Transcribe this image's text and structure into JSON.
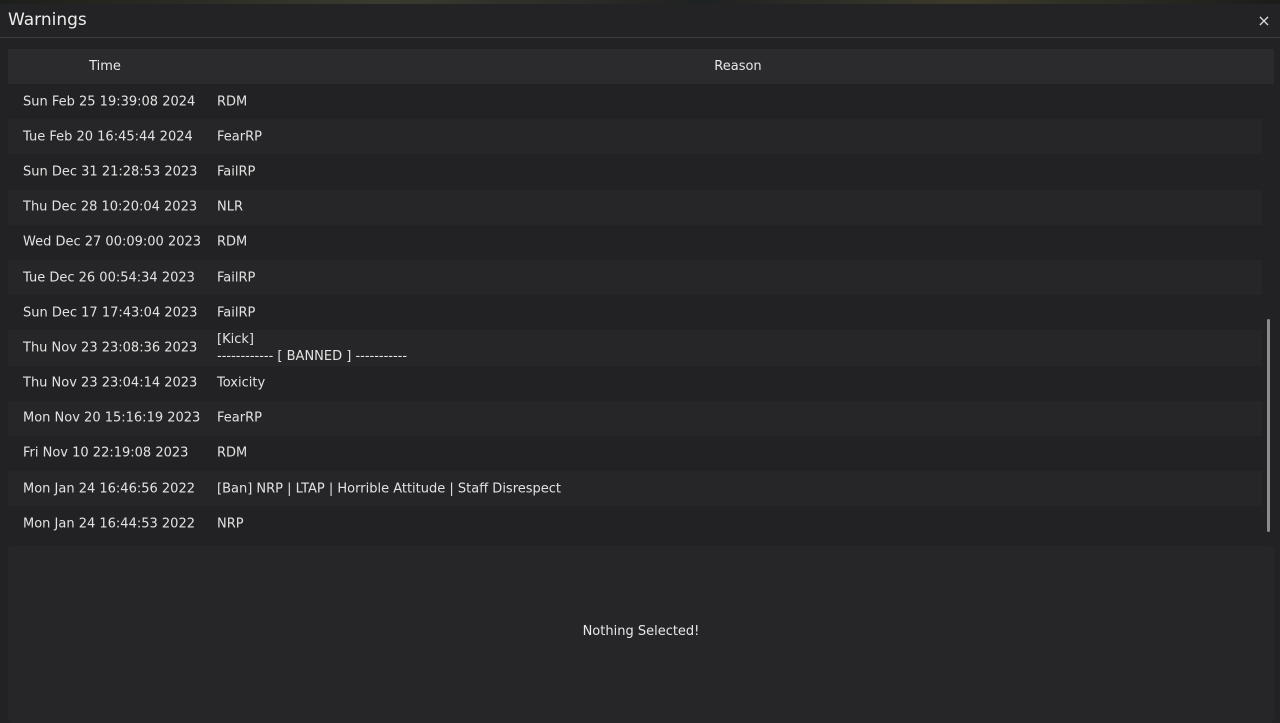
{
  "window": {
    "title": "Warnings",
    "close_icon": "×"
  },
  "table": {
    "columns": [
      "Time",
      "Reason"
    ],
    "rows": [
      {
        "time": "Sun Feb 25 19:39:08 2024",
        "reason": "RDM"
      },
      {
        "time": "Tue Feb 20 16:45:44 2024",
        "reason": "FearRP"
      },
      {
        "time": "Sun Dec 31 21:28:53 2023",
        "reason": "FailRP"
      },
      {
        "time": "Thu Dec 28 10:20:04 2023",
        "reason": "NLR"
      },
      {
        "time": "Wed Dec 27 00:09:00 2023",
        "reason": "RDM"
      },
      {
        "time": "Tue Dec 26 00:54:34 2023",
        "reason": "FailRP"
      },
      {
        "time": "Sun Dec 17 17:43:04 2023",
        "reason": "FailRP"
      },
      {
        "time": "Thu Nov 23 23:08:36 2023",
        "reason": "[Kick]\n------------ [ BANNED ] -----------"
      },
      {
        "time": "Thu Nov 23 23:04:14 2023",
        "reason": "Toxicity"
      },
      {
        "time": "Mon Nov 20 15:16:19 2023",
        "reason": "FearRP"
      },
      {
        "time": "Fri Nov 10 22:19:08 2023",
        "reason": "RDM"
      },
      {
        "time": "Mon Jan 24 16:46:56 2022",
        "reason": "[Ban] NRP | LTAP | Horrible Attitude | Staff Disrespect"
      },
      {
        "time": "Mon Jan 24 16:44:53 2022",
        "reason": "NRP"
      }
    ]
  },
  "detail": {
    "empty_text": "Nothing Selected!"
  },
  "colors": {
    "background": "#222224",
    "header": "#2b2b2e",
    "row_alt": "#262628",
    "text": "#e2e2e2"
  }
}
